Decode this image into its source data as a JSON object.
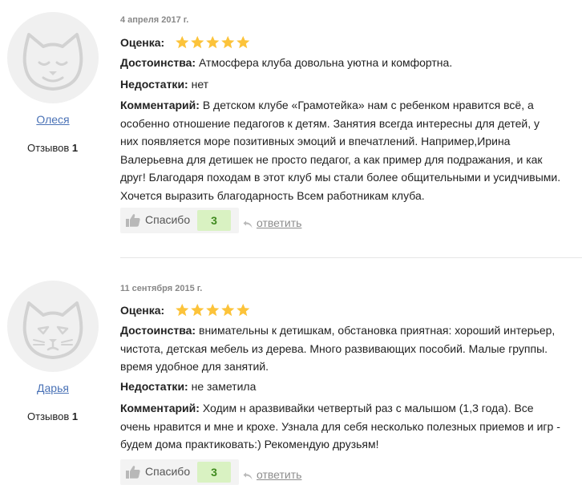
{
  "labels": {
    "rating": "Оценка:",
    "pros": "Достоинства:",
    "cons": "Недостатки:",
    "comment": "Комментарий:",
    "reviews_count": "Отзывов",
    "like": "Спасибо",
    "reply": "ответить"
  },
  "colors": {
    "star": "#fcc33a",
    "link": "#4a72b6",
    "like_count_bg": "#d9f2c2",
    "like_count_text": "#3f8a1e"
  },
  "reviews": [
    {
      "user": "Олеся",
      "reviews_count": "1",
      "date": "4 апреля 2017 г.",
      "rating": 5,
      "pros": "Атмосфера клуба довольна уютна и комфортна.",
      "cons": "нет",
      "comment_lines": [
        "В детском клубе «Грамотейка» нам с ребенком нравится всё, а",
        "особенно отношение педагогов к детям. Занятия всегда интересны для детей, у",
        "них появляется море позитивных эмоций и впечатлений. Например,Ирина",
        "Валерьевна для детишек не просто педагог, а как пример для подражания, и как",
        "друг! Благодаря походам в этот клуб мы стали более общительными и усидчивыми.",
        "Хочется выразить благодарность Всем работникам клуба."
      ],
      "likes": "3"
    },
    {
      "user": "Дарья",
      "reviews_count": "1",
      "date": "11 сентября 2015 г.",
      "rating": 5,
      "pros_lines": [
        "внимательны к детишкам, обстановка приятная: хороший интерьер,",
        "чистота, детская мебель из дерева. Много развивающих пособий. Малые группы.",
        "время удобное для занятий."
      ],
      "cons": "не заметила",
      "comment_lines": [
        "Ходим н аразвивайки четвертый раз с малышом (1,3 года). Все",
        "очень нравится и мне и крохе. Узнала для себя несколько полезных приемов и игр -",
        "будем дома практиковать:) Рекомендую друзьям!"
      ],
      "likes": "3"
    }
  ]
}
